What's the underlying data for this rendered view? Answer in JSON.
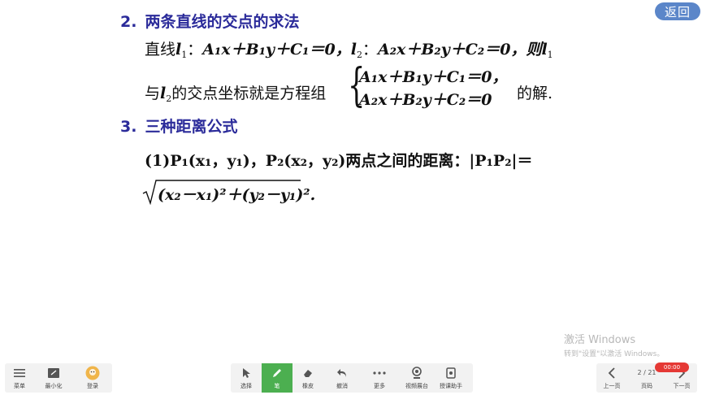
{
  "back_button": "返回",
  "section2": {
    "number": "2.",
    "title": "两条直线的交点的求法",
    "line1_prefix": "直线",
    "line1_l1": "l",
    "line1_l1_sub": "1",
    "line1_colon1": "：",
    "eq_l1": "A₁x＋B₁y＋C₁＝0，",
    "line1_l2": "l",
    "line1_l2_sub": "2",
    "line1_colon2": "：",
    "eq_l2": "A₂x＋B₂y＋C₂＝0，则",
    "line1_end": "l",
    "line1_end_sub": "1",
    "line2_prefix": "与",
    "line2_l": "l",
    "line2_l_sub": "2",
    "line2_mid": "的交点坐标就是方程组",
    "system_eq1": "A₁x＋B₁y＋C₁＝0，",
    "system_eq2": "A₂x＋B₂y＋C₂＝0",
    "line2_suffix": "的解."
  },
  "section3": {
    "number": "3.",
    "title": "三种距离公式",
    "item1_a": "(1)P₁(x₁，y₁)，P₂(x₂，y₂)两点之间的距离：|P₁P₂|＝",
    "item1_b": "(x₂－x₁)²＋(y₂－y₁)².",
    "sqrt_expression": "√"
  },
  "watermark": {
    "line1": "激活 Windows",
    "line2": "转到\"设置\"以激活 Windows。"
  },
  "toolbar": {
    "left": [
      {
        "label": "菜单",
        "icon": "menu-icon"
      },
      {
        "label": "最小化",
        "icon": "minimize-icon"
      },
      {
        "label": "登录",
        "icon": "avatar-icon"
      }
    ],
    "center": [
      {
        "label": "选择",
        "icon": "cursor-icon"
      },
      {
        "label": "笔",
        "icon": "pen-icon"
      },
      {
        "label": "橡皮",
        "icon": "eraser-icon"
      },
      {
        "label": "撤消",
        "icon": "undo-icon"
      },
      {
        "label": "更多",
        "icon": "more-icon"
      },
      {
        "label": "视频展台",
        "icon": "camera-icon"
      },
      {
        "label": "授课助手",
        "icon": "assistant-icon"
      }
    ],
    "right": [
      {
        "label": "上一页",
        "icon": "chevron-left-icon"
      },
      {
        "label": "页码",
        "value": "2 / 21"
      },
      {
        "label": "下一页",
        "icon": "chevron-right-icon"
      }
    ],
    "timer": "00:00",
    "active_tool_color": "#4caf50"
  }
}
